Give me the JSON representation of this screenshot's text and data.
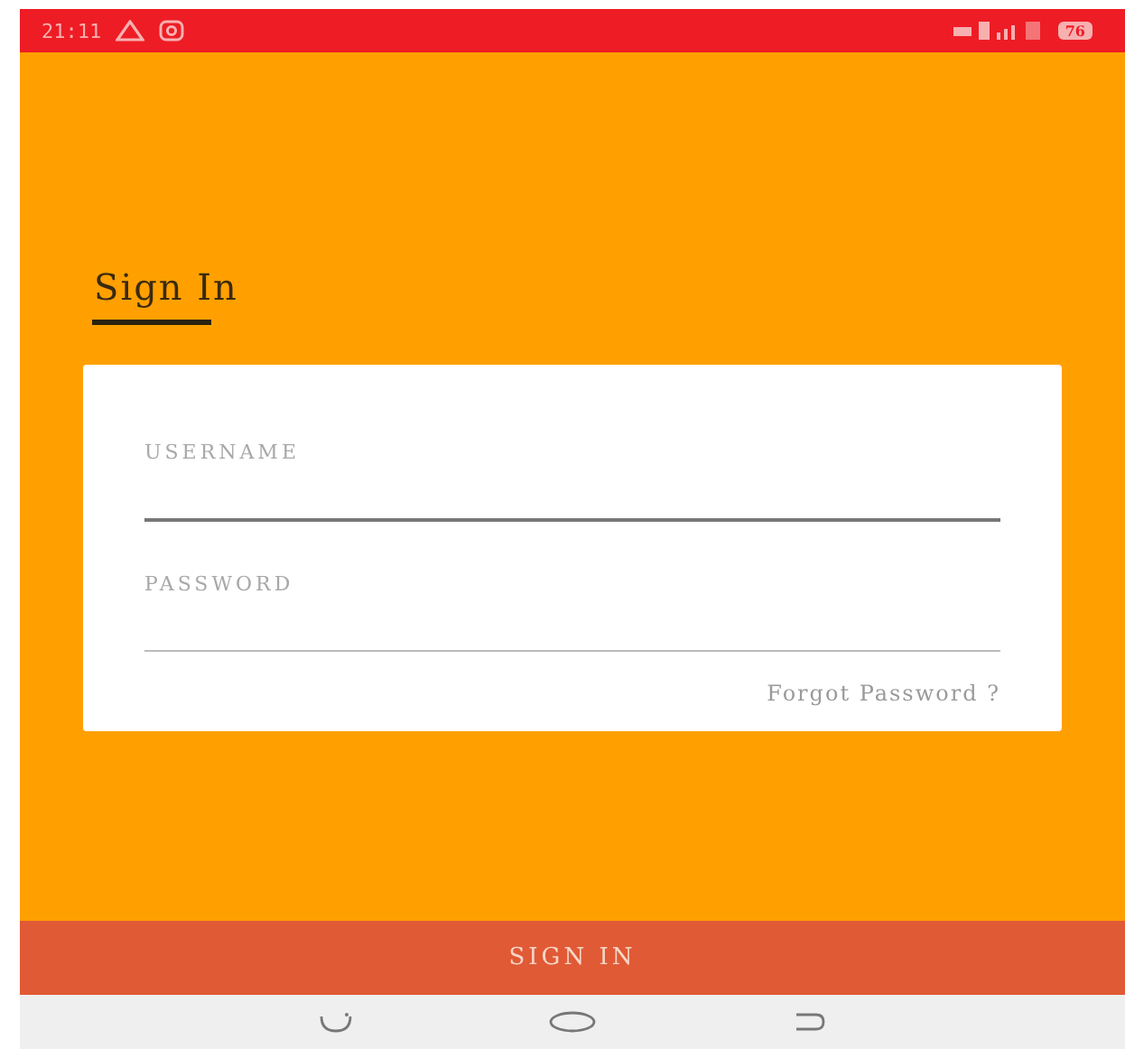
{
  "status_bar": {
    "time": "21:11",
    "battery": "76"
  },
  "title": "Sign In",
  "fields": [
    {
      "placeholder": "USERNAME",
      "focused": true
    },
    {
      "placeholder": "PASSWORD",
      "focused": false
    }
  ],
  "forgot_link": "Forgot Password ?",
  "sign_in_button": "SIGN IN"
}
